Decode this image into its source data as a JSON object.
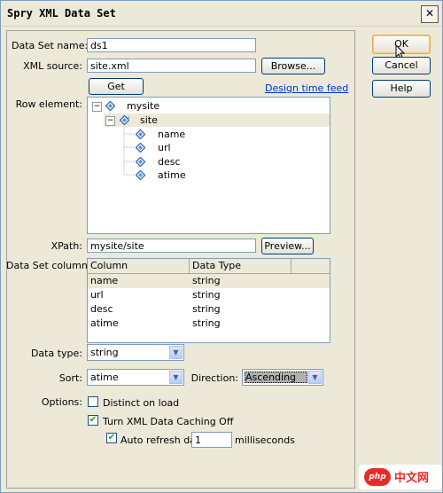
{
  "window": {
    "title": "Spry XML Data Set"
  },
  "form": {
    "dataset_name_label": "Data Set name:",
    "dataset_name_value": "ds1",
    "xml_source_label": "XML source:",
    "xml_source_value": "site.xml",
    "browse_label": "Browse...",
    "get_schema_label": "Get schema",
    "design_time_feed_label": "Design time feed",
    "row_element_label": "Row element:",
    "tree": [
      {
        "label": "mysite",
        "expander": "−",
        "icon": "xml-element-icon"
      },
      {
        "label": "site",
        "expander": "−",
        "icon": "xml-repeating-element-icon"
      },
      {
        "label": "name",
        "icon": "xml-element-icon"
      },
      {
        "label": "url",
        "icon": "xml-element-icon"
      },
      {
        "label": "desc",
        "icon": "xml-element-icon"
      },
      {
        "label": "atime",
        "icon": "xml-element-icon"
      }
    ],
    "xpath_label": "XPath:",
    "xpath_value": "mysite/site",
    "preview_label": "Preview...",
    "columns_label": "Data Set columns:",
    "columns_headers": [
      "Column",
      "Data Type"
    ],
    "columns_rows": [
      [
        "name",
        "string"
      ],
      [
        "url",
        "string"
      ],
      [
        "desc",
        "string"
      ],
      [
        "atime",
        "string"
      ]
    ],
    "data_type_label": "Data type:",
    "data_type_value": "string",
    "sort_label": "Sort:",
    "sort_value": "atime",
    "direction_label": "Direction:",
    "direction_value": "Ascending",
    "options_label": "Options:",
    "distinct_label": "Distinct on load",
    "distinct_checked": false,
    "caching_label": "Turn XML Data Caching Off",
    "caching_checked": true,
    "autorefresh_label": "Auto refresh data",
    "autorefresh_checked": true,
    "autorefresh_value": "1",
    "milliseconds_label": "milliseconds"
  },
  "buttons": {
    "ok": "OK",
    "cancel": "Cancel",
    "help": "Help"
  },
  "watermark": {
    "logo": "php",
    "text": "中文网"
  },
  "colors": {
    "link": "#0033cc",
    "selection": "#ece9d8",
    "check": "#21a121",
    "watermark": "#e52d27"
  }
}
